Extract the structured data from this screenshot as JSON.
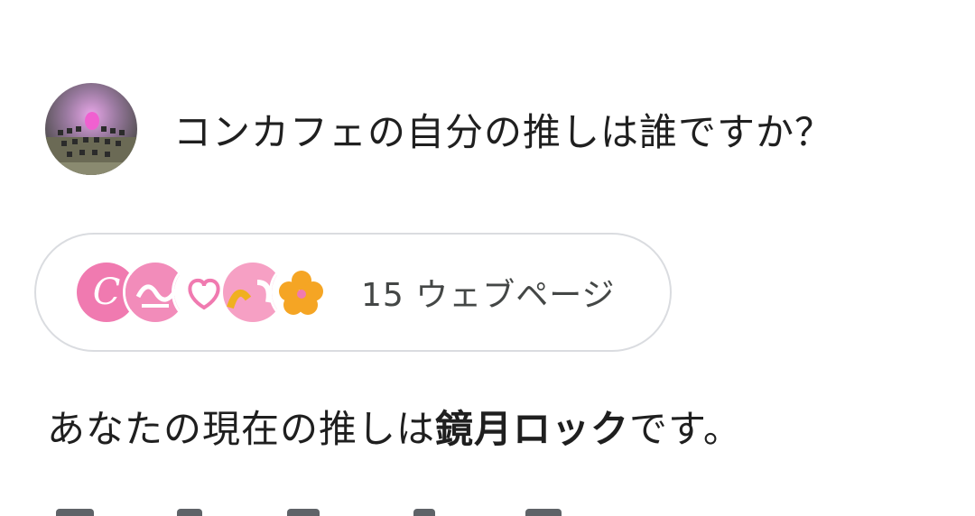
{
  "query": {
    "avatar_icon": "user-avatar-photo",
    "text": "コンカフェの自分の推しは誰ですか？"
  },
  "sources": {
    "favicons": [
      "site-favicon-pink-c",
      "site-favicon-pink-script",
      "site-favicon-heart",
      "site-favicon-yellow-pink",
      "site-favicon-orange-flower"
    ],
    "count_label": "15 ウェブページ"
  },
  "answer": {
    "prefix": "あなたの現在の推しは",
    "highlight": "鏡月ロック",
    "suffix": "です。"
  },
  "colors": {
    "chip_border": "#dadce0",
    "text_primary": "#1f1f1f",
    "text_secondary": "#444746"
  }
}
